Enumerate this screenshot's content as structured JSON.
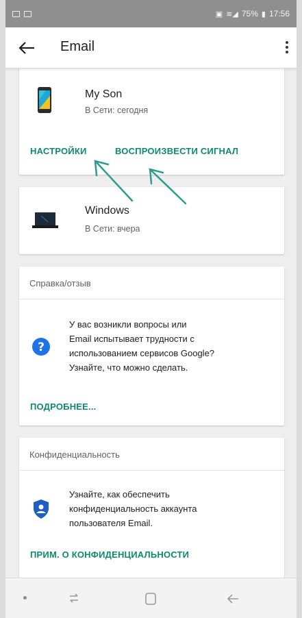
{
  "status_bar": {
    "battery_percent": "75%",
    "time": "17:56"
  },
  "app_bar": {
    "title": "Email",
    "back_icon": "arrow-back-icon",
    "more_icon": "more-vert-icon"
  },
  "devices": [
    {
      "name": "My Son",
      "status": "В Сети: сегодня",
      "icon": "smartphone-icon",
      "actions": [
        "НАСТРОЙКИ",
        "ВОСПРОИЗВЕСТИ СИГНАЛ"
      ]
    },
    {
      "name": "Windows",
      "status": "В Сети: вчера",
      "icon": "laptop-icon"
    }
  ],
  "help_card": {
    "header": "Справка/отзыв",
    "lines": [
      "У вас возникли вопросы или",
      "Email испытывает трудности с",
      "использованием сервисов Google?",
      "Узнайте, что можно сделать."
    ],
    "link": "ПОДРОБНЕЕ...",
    "icon": "help-circle-icon"
  },
  "privacy_card": {
    "header": "Конфиденциальность",
    "lines": [
      "Узнайте, как обеспечить",
      "конфиденциальность аккаунта",
      "пользователя Email."
    ],
    "link": "ПРИМ. О КОНФИДЕНЦИАЛЬНОСТИ",
    "icon": "shield-user-icon"
  },
  "colors": {
    "accent": "#0e8a6f",
    "arrow": "#2a9d8f",
    "help_blue": "#1e73e8"
  },
  "nav_bar": {
    "icons": [
      "nav-dot-icon",
      "recent-apps-icon",
      "home-icon",
      "back-icon"
    ]
  }
}
